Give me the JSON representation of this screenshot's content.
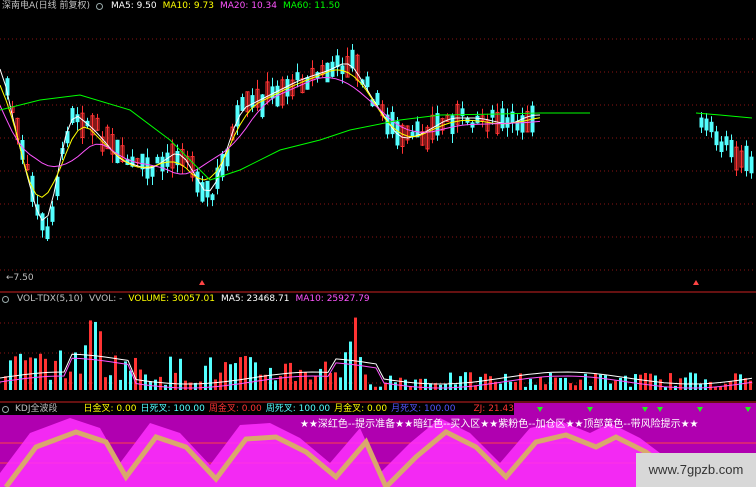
{
  "price_header": {
    "title": "深南电A(日线 前复权)",
    "ma5": "MA5: 9.50",
    "ma10": "MA10: 9.73",
    "ma20": "MA20: 10.34",
    "ma60": "MA60: 11.50"
  },
  "price_low_label": "←7.50",
  "vol_header": {
    "title": "VOL-TDX(5,10)",
    "vvol": "VVOL: -",
    "volume": "VOLUME: 30057.01",
    "ma5": "MA5: 23468.71",
    "ma10": "MA10: 25927.79"
  },
  "kdj_header": {
    "title": "KDJ全波段",
    "items": [
      {
        "label": "日金叉: 0.00"
      },
      {
        "label": "日死叉: 100.00"
      },
      {
        "label": "周金叉: 0.00"
      },
      {
        "label": "周死叉: 100.00"
      },
      {
        "label": "月金叉: 0.00"
      },
      {
        "label": "月死叉: 100.00"
      },
      {
        "label": "ZJ: 21.43"
      }
    ]
  },
  "kdj_annotation": "★★深红色--提示准备★★暗红色--买入区★★紫粉色--加仓区★★顶部黄色--带风险提示★★",
  "watermark": "www.7gpzb.com",
  "colors": {
    "up": "#ff3333",
    "down": "#54ffff",
    "ma5": "#ffffff",
    "ma10": "#ffff00",
    "ma20": "#ff55ff",
    "ma60": "#00ff00",
    "kdj_bg": "#b000b0",
    "kdj_pink": "#ff30ff",
    "kdj_tan": "#d9a86c"
  }
}
